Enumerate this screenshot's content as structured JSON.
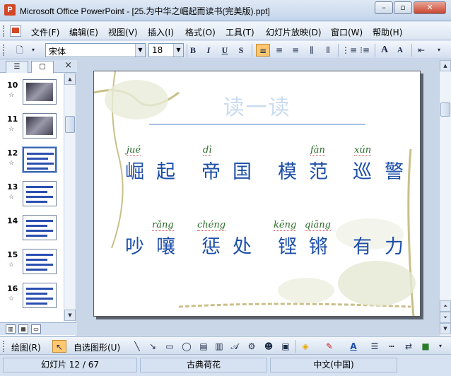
{
  "window": {
    "title": "Microsoft Office PowerPoint - [25.为中华之崛起而读书(完美版).ppt]",
    "app_icon_label": "P",
    "minimize_icon": "minimize-icon",
    "maximize_icon": "maximize-icon",
    "close_icon": "close-icon"
  },
  "menubar": {
    "items": [
      {
        "label": "文件(F)"
      },
      {
        "label": "编辑(E)"
      },
      {
        "label": "视图(V)"
      },
      {
        "label": "插入(I)"
      },
      {
        "label": "格式(O)"
      },
      {
        "label": "工具(T)"
      },
      {
        "label": "幻灯片放映(D)"
      },
      {
        "label": "窗口(W)"
      },
      {
        "label": "帮助(H)"
      }
    ]
  },
  "toolbar": {
    "font_name": "宋体",
    "font_size": "18",
    "bold": "B",
    "italic": "I",
    "underline": "U",
    "shadow": "S",
    "grow_font": "A",
    "shrink_font": "A"
  },
  "left_pane": {
    "tab_outline_icon": "outline-icon",
    "tab_slides_icon": "slides-icon",
    "close": "×",
    "thumbnails": [
      {
        "num": "10",
        "star": "☆"
      },
      {
        "num": "11",
        "star": "☆"
      },
      {
        "num": "12",
        "star": "☆",
        "selected": true
      },
      {
        "num": "13",
        "star": "☆"
      },
      {
        "num": "14",
        "star": ""
      },
      {
        "num": "15",
        "star": "☆"
      },
      {
        "num": "16",
        "star": "☆"
      }
    ]
  },
  "slide": {
    "title": "读一读",
    "row1": {
      "chars": [
        "崛",
        "起",
        "帝",
        "国",
        "模",
        "范",
        "巡",
        "警"
      ],
      "pinyin": [
        {
          "text": "jué",
          "over": 0
        },
        {
          "text": "dì",
          "over": 2
        },
        {
          "text": "fàn",
          "over": 5
        },
        {
          "text": "xún",
          "over": 6
        }
      ]
    },
    "row2": {
      "chars": [
        "吵",
        "嚷",
        "惩",
        "处",
        "铿",
        "锵",
        "有",
        "力"
      ],
      "pinyin": [
        {
          "text": "rǎng",
          "over": 1
        },
        {
          "text": "chéng",
          "over": 2
        },
        {
          "text": "kēng",
          "over": 4
        },
        {
          "text": "qiāng",
          "over": 5
        }
      ]
    }
  },
  "drawbar": {
    "draw_label": "绘图(R)",
    "autoshape_label": "自选图形(U)"
  },
  "statusbar": {
    "slide_info": "幻灯片 12 / 67",
    "design": "古典荷花",
    "language": "中文(中国)"
  },
  "colors": {
    "accent_blue": "#1c4fa8",
    "selected_tool": "#ffc870"
  }
}
